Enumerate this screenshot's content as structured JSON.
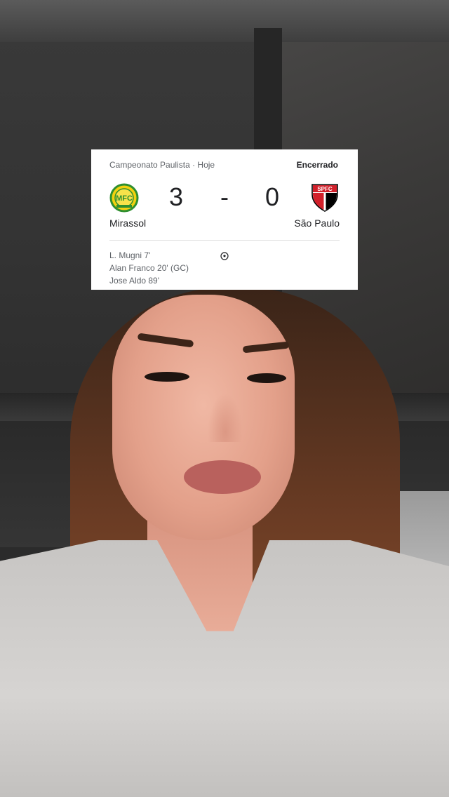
{
  "match_card": {
    "competition": "Campeonato Paulista · Hoje",
    "status": "Encerrado",
    "home": {
      "name": "Mirassol",
      "score": "3",
      "logo_text": "MFC",
      "logo_icon": "mirassol-crest-icon"
    },
    "away": {
      "name": "São Paulo",
      "score": "0",
      "logo_text": "SPFC",
      "logo_icon": "sao-paulo-crest-icon"
    },
    "separator": "-",
    "goal_icon": "soccer-ball-icon",
    "scorers": [
      "L. Mugni 7'",
      "Alan Franco 20' (GC)",
      "Jose Aldo 89'"
    ]
  },
  "colors": {
    "card_bg": "#ffffff",
    "primary_text": "#202124",
    "secondary_text": "#5f6368",
    "mirassol_yellow": "#f2d10f",
    "mirassol_green": "#2f8f2f",
    "spfc_red": "#d2202a",
    "spfc_black": "#000000"
  }
}
